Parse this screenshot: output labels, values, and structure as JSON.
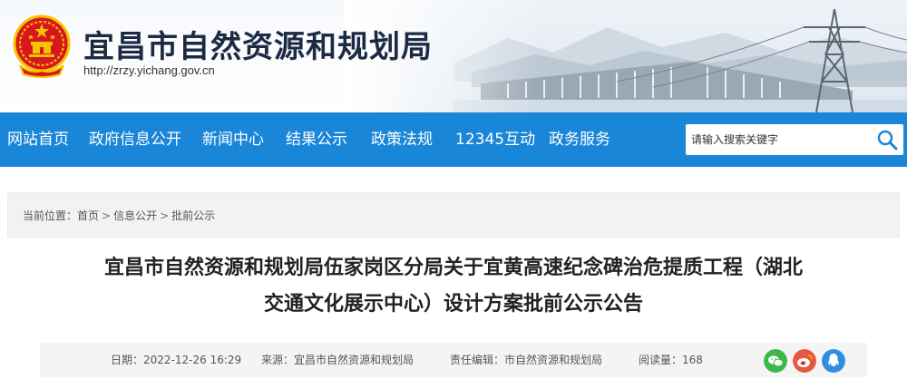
{
  "header": {
    "title": "宜昌市自然资源和规划局",
    "url": "http://zrzy.yichang.gov.cn"
  },
  "nav": {
    "items": [
      {
        "label": "网站首页"
      },
      {
        "label": "政府信息公开"
      },
      {
        "label": "新闻中心"
      },
      {
        "label": "结果公示"
      },
      {
        "label": "政策法规"
      },
      {
        "label": "12345互动"
      },
      {
        "label": "政务服务"
      }
    ]
  },
  "search": {
    "placeholder": "请输入搜索关键字",
    "icon": "search-icon"
  },
  "breadcrumb": {
    "prefix": "当前位置：",
    "items": [
      "首页",
      "信息公开",
      "批前公示"
    ],
    "separator": ">"
  },
  "article": {
    "title_line1": "宜昌市自然资源和规划局伍家岗区分局关于宜黄高速纪念碑治危提质工程（湖北",
    "title_line2": "交通文化展示中心）设计方案批前公示公告"
  },
  "meta": {
    "date_label": "日期：",
    "date_value": "2022-12-26 16:29",
    "source_label": "来源：",
    "source_value": "宜昌市自然资源和规划局",
    "editor_label": "责任编辑：",
    "editor_value": "市自然资源和规划局",
    "reads_label": "阅读量：",
    "reads_value": "168"
  },
  "share": {
    "icons": [
      "wechat-icon",
      "weibo-icon",
      "qzone-icon"
    ],
    "colors": {
      "wechat": "#3db84a",
      "weibo": "#e8573f",
      "qzone": "#2e8fe0"
    }
  },
  "colors": {
    "nav_bg": "#1a86d8",
    "title_text": "#1c2a44",
    "emblem_red": "#d7161e",
    "emblem_gold": "#f5c400"
  }
}
